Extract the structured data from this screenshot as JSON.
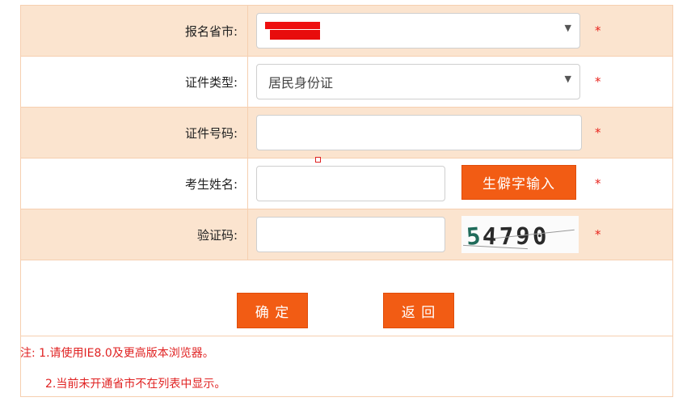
{
  "form": {
    "province": {
      "label": "报名省市:",
      "value": "",
      "required_mark": "*"
    },
    "id_type": {
      "label": "证件类型:",
      "value": "居民身份证",
      "required_mark": "*"
    },
    "id_number": {
      "label": "证件号码:",
      "value": "",
      "required_mark": "*"
    },
    "name": {
      "label": "考生姓名:",
      "value": "",
      "rare_char_button": "生僻字输入",
      "required_mark": "*"
    },
    "captcha": {
      "label": "验证码:",
      "value": "",
      "image_text": "54790",
      "required_mark": "*"
    }
  },
  "actions": {
    "confirm": "确 定",
    "back": "返 回"
  },
  "notes": {
    "line1": "注: 1.请使用IE8.0及更高版本浏览器。",
    "line2": "2.当前未开通省市不在列表中显示。"
  },
  "colors": {
    "accent": "#f25c14",
    "row_alt_bg": "#fbe4cf",
    "border": "#f6cfb0",
    "required": "#e8241d"
  },
  "icons": {
    "dropdown": "chevron-down-icon"
  }
}
